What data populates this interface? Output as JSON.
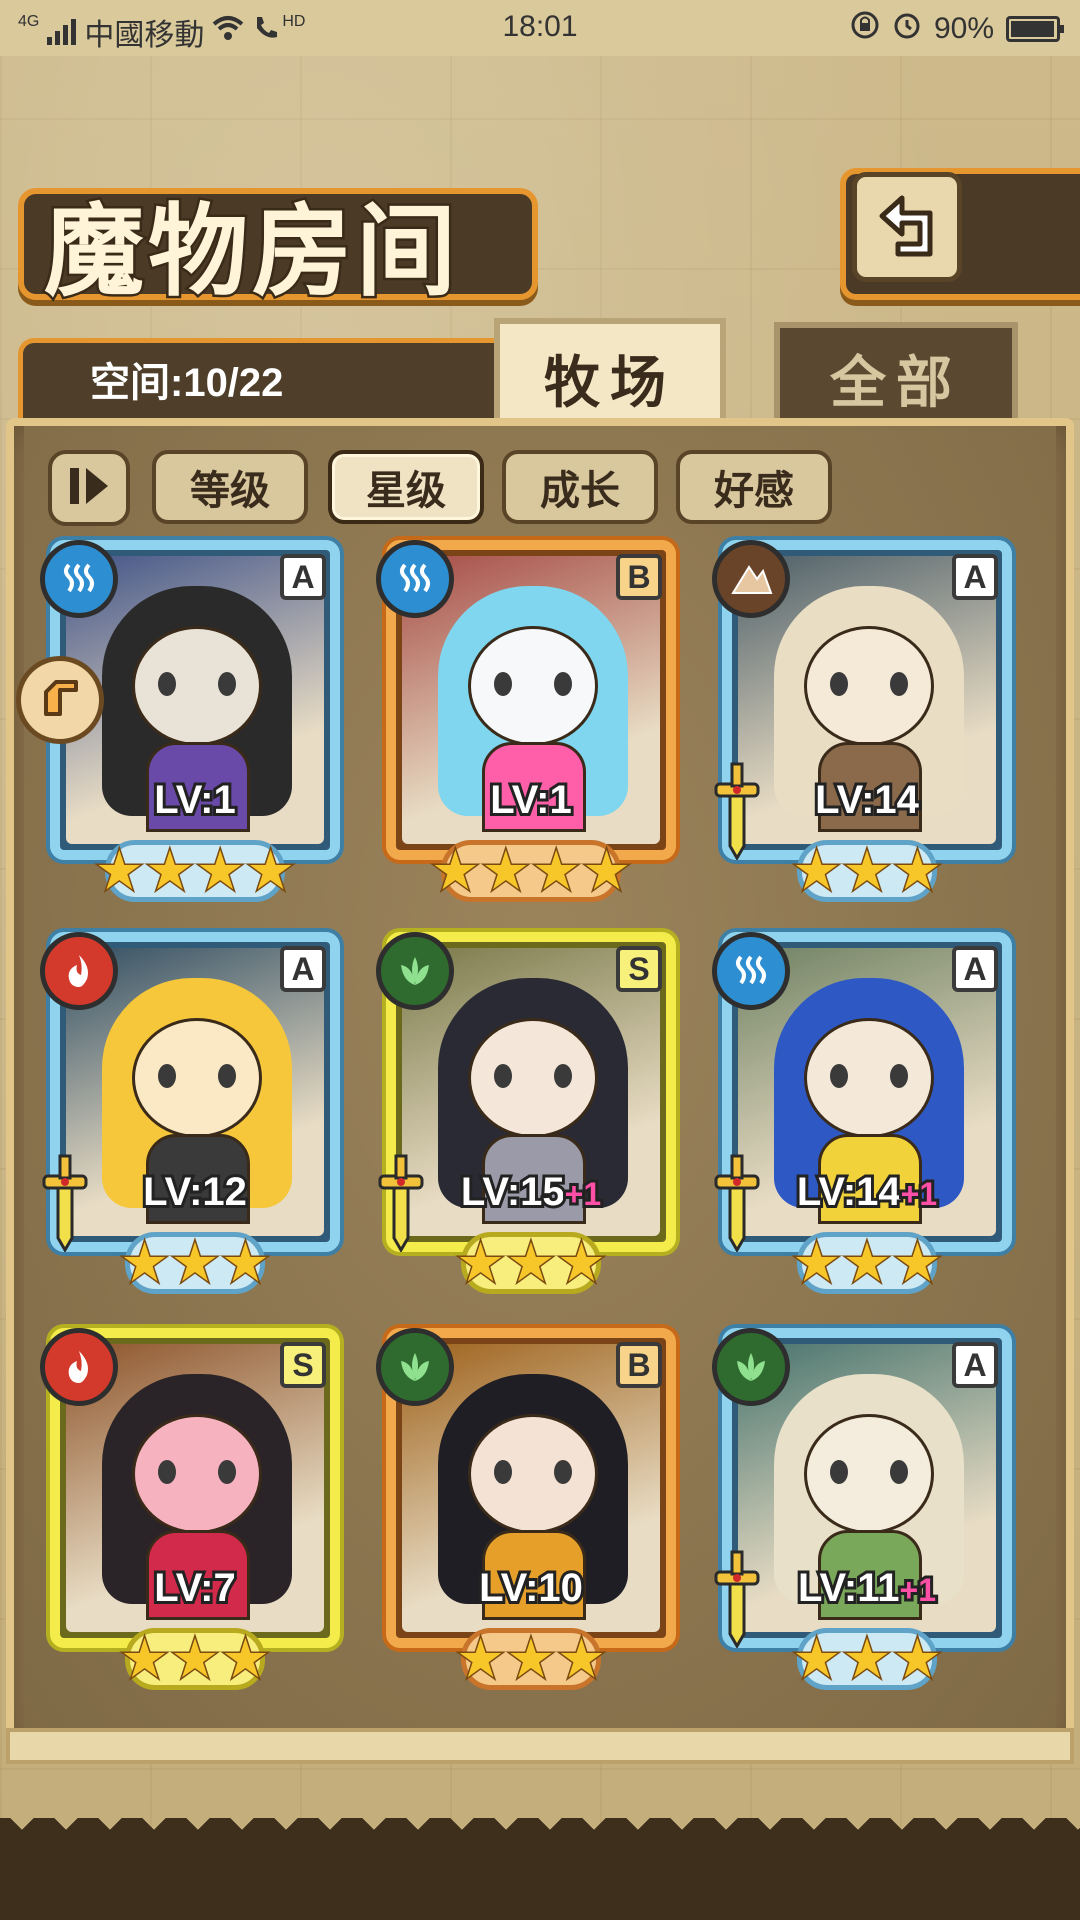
{
  "status_bar": {
    "network": "4G",
    "carrier": "中國移動",
    "hd_label": "HD",
    "time": "18:01",
    "battery_percent": "90%",
    "battery_level": 0.9
  },
  "header": {
    "title": "魔物房间",
    "back_icon": "back-arrow-icon"
  },
  "capacity": {
    "label": "空间:10/22"
  },
  "tabs": [
    {
      "label": "牧场",
      "active": true
    },
    {
      "label": "全部",
      "active": false
    }
  ],
  "filters": [
    {
      "label": "等级",
      "active": false
    },
    {
      "label": "星级",
      "active": true
    },
    {
      "label": "成长",
      "active": false
    },
    {
      "label": "好感",
      "active": false
    }
  ],
  "monsters": [
    {
      "element": "water",
      "rank": "A",
      "frame": "blue",
      "level": "LV:1",
      "bonus": "",
      "stars": 4,
      "weapon": false,
      "leader": true,
      "palette": [
        "#e9e2d6",
        "#2a2a2a",
        "#6a4aa8"
      ]
    },
    {
      "element": "water",
      "rank": "B",
      "frame": "orange",
      "level": "LV:1",
      "bonus": "",
      "stars": 4,
      "weapon": false,
      "leader": false,
      "palette": [
        "#f6f8fa",
        "#7fd6ee",
        "#ff5fa8"
      ]
    },
    {
      "element": "earth",
      "rank": "A",
      "frame": "blue",
      "level": "LV:14",
      "bonus": "",
      "stars": 3,
      "weapon": true,
      "leader": false,
      "palette": [
        "#f5ead8",
        "#e9ddc4",
        "#8a6a4a"
      ]
    },
    {
      "element": "fire",
      "rank": "A",
      "frame": "blue",
      "level": "LV:12",
      "bonus": "",
      "stars": 3,
      "weapon": true,
      "leader": false,
      "palette": [
        "#fbe8c4",
        "#f6c73a",
        "#3a3a3a"
      ]
    },
    {
      "element": "wood",
      "rank": "S",
      "frame": "yellow",
      "level": "LV:15",
      "bonus": "+1",
      "stars": 3,
      "weapon": true,
      "leader": false,
      "palette": [
        "#f4e6d8",
        "#2a2a34",
        "#9a9aa8"
      ]
    },
    {
      "element": "water",
      "rank": "A",
      "frame": "blue",
      "level": "LV:14",
      "bonus": "+1",
      "stars": 3,
      "weapon": true,
      "leader": false,
      "palette": [
        "#f4e8d8",
        "#2e58c4",
        "#f2d23a"
      ]
    },
    {
      "element": "fire",
      "rank": "S",
      "frame": "yellow",
      "level": "LV:7",
      "bonus": "",
      "stars": 3,
      "weapon": false,
      "leader": false,
      "palette": [
        "#f7b2c0",
        "#2a2428",
        "#d22a4a"
      ]
    },
    {
      "element": "wood",
      "rank": "B",
      "frame": "orange",
      "level": "LV:10",
      "bonus": "",
      "stars": 3,
      "weapon": false,
      "leader": false,
      "palette": [
        "#f4e2d4",
        "#1e1e24",
        "#e6a02a"
      ]
    },
    {
      "element": "wood",
      "rank": "A",
      "frame": "blue",
      "level": "LV:11",
      "bonus": "+1",
      "stars": 3,
      "weapon": true,
      "leader": false,
      "palette": [
        "#f4ecdc",
        "#e8e0c8",
        "#7aa85a"
      ]
    }
  ],
  "colors": {
    "accent_orange": "#e6962f",
    "panel_brown": "#8d7550",
    "plus_pink": "#ff4fa7"
  }
}
